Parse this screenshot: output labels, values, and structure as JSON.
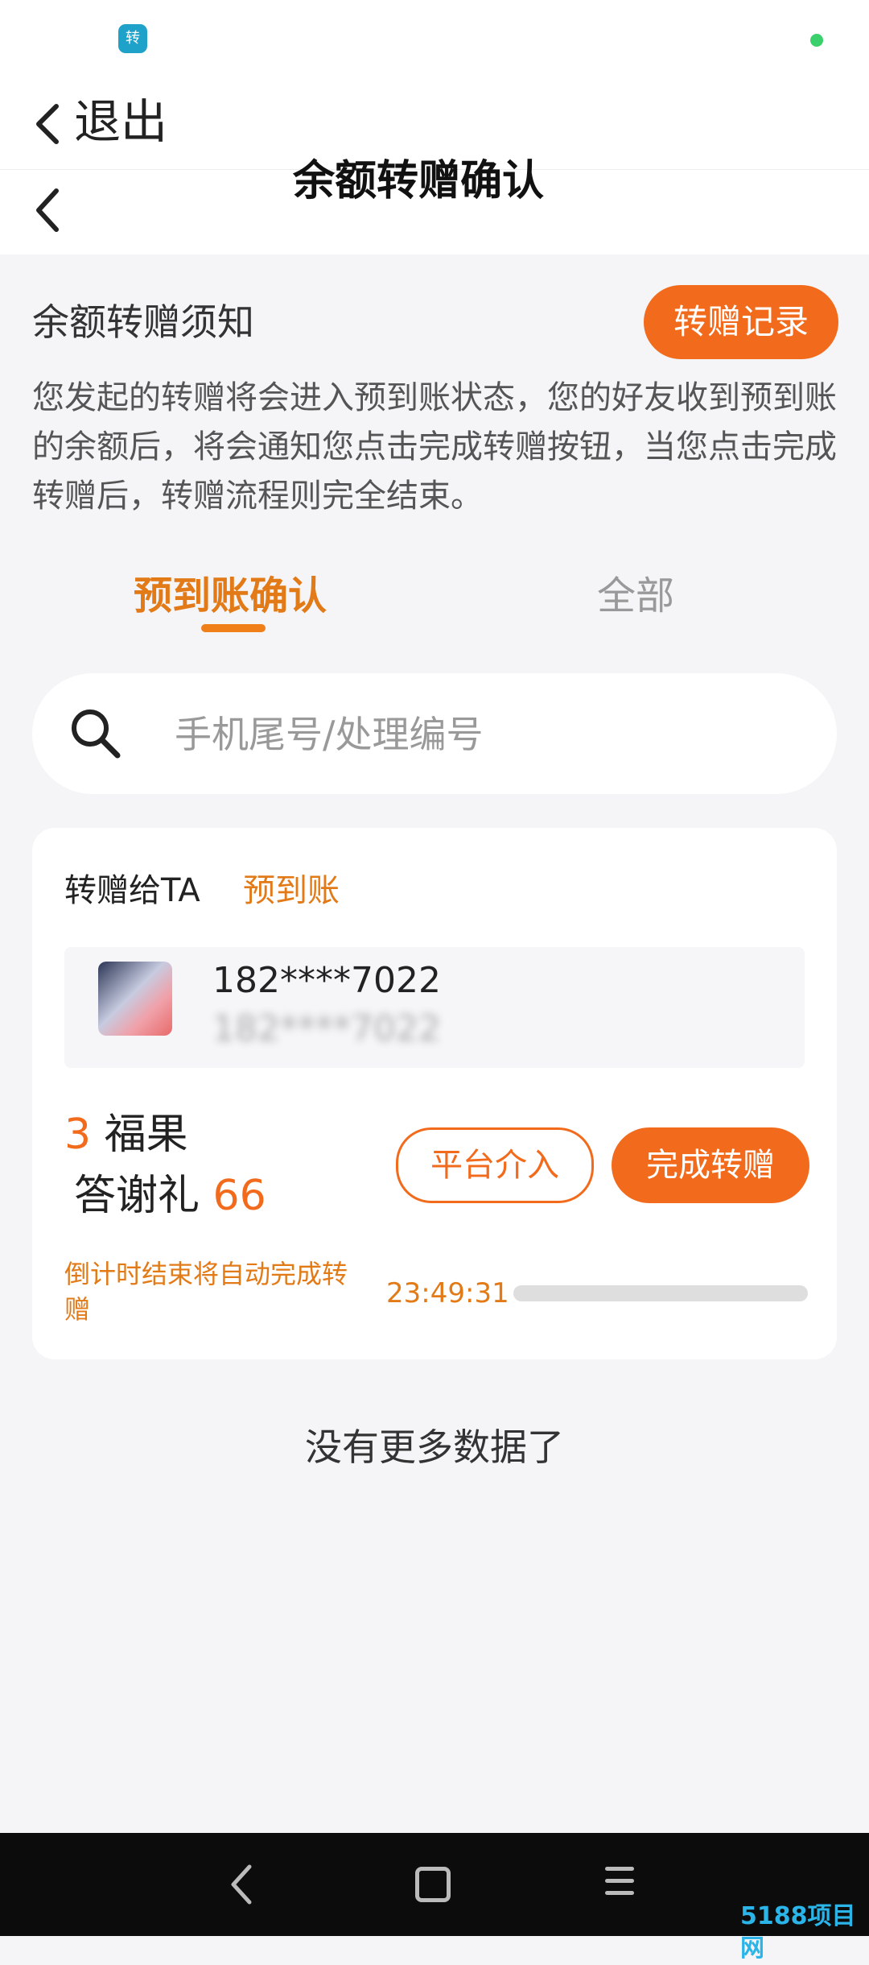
{
  "status_bar": {
    "app_badge_text": "转"
  },
  "exit_bar": {
    "label": "退出"
  },
  "header": {
    "title": "余额转赠确认"
  },
  "notice": {
    "title": "余额转赠须知",
    "records_button": "转赠记录",
    "body": "您发起的转赠将会进入预到账状态，您的好友收到预到账的余额后，将会通知您点击完成转赠按钮，当您点击完成转赠后，转赠流程则完全结束。"
  },
  "tabs": [
    {
      "label": "预到账确认",
      "active": true
    },
    {
      "label": "全部",
      "active": false
    }
  ],
  "search": {
    "placeholder": "手机尾号/处理编号",
    "value": ""
  },
  "transfer_card": {
    "direction_label": "转赠给TA",
    "status": "预到账",
    "recipient_phone": "182****7022",
    "recipient_phone_secondary": "182****7022",
    "amount_value": "3",
    "amount_unit": "福果",
    "gift_label": "答谢礼",
    "gift_value": "66",
    "platform_button": "平台介入",
    "complete_button": "完成转赠",
    "countdown_label": "倒计时结束将自动完成转赠",
    "countdown_time": "23:49:31"
  },
  "footer_text": "没有更多数据了",
  "watermark": "5188项目网",
  "colors": {
    "accent": "#f26a1b",
    "accent_text": "#e27a17",
    "background": "#f5f5f7"
  }
}
